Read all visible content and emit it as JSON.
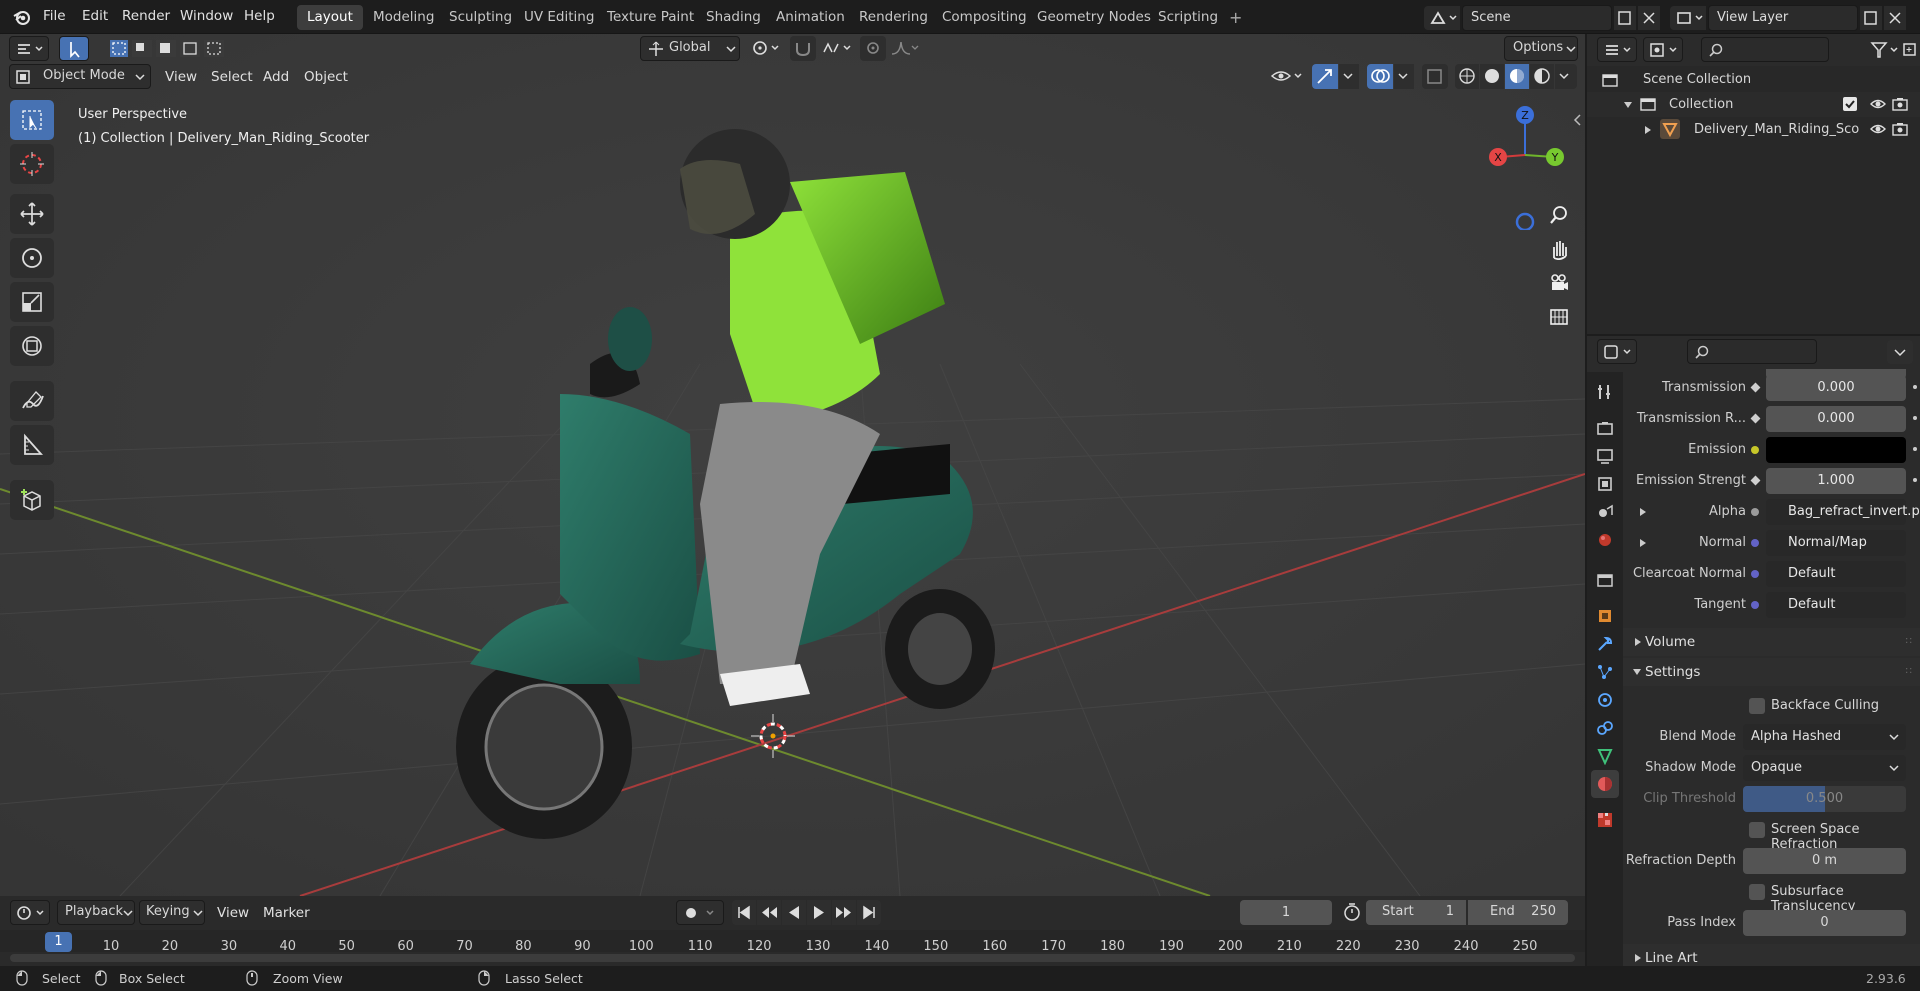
{
  "menus": [
    "File",
    "Edit",
    "Render",
    "Window",
    "Help"
  ],
  "workspaces": [
    "Layout",
    "Modeling",
    "Sculpting",
    "UV Editing",
    "Texture Paint",
    "Shading",
    "Animation",
    "Rendering",
    "Compositing",
    "Geometry Nodes",
    "Scripting"
  ],
  "scene": {
    "label": "Scene"
  },
  "view_layer": {
    "label": "View Layer"
  },
  "vp": {
    "mode": "Object Mode",
    "menu": [
      "View",
      "Select",
      "Add",
      "Object"
    ],
    "orientation": "Global",
    "options": "Options",
    "overlay_title": "User Perspective",
    "overlay_sub": "(1) Collection | Delivery_Man_Riding_Scooter",
    "gizmo": {
      "x": "X",
      "y": "Y",
      "z": "Z"
    }
  },
  "outliner": {
    "root": "Scene Collection",
    "collection": "Collection",
    "object": "Delivery_Man_Riding_Sco"
  },
  "props": {
    "rows": [
      {
        "label": "Transmission",
        "value": "0.000"
      },
      {
        "label": "Transmission R...",
        "value": "0.000"
      },
      {
        "label": "Emission",
        "value": ""
      },
      {
        "label": "Emission Strengt",
        "value": "1.000"
      },
      {
        "label": "Alpha",
        "value": "Bag_refract_invert.p..."
      },
      {
        "label": "Normal",
        "value": "Normal/Map"
      },
      {
        "label": "Clearcoat Normal",
        "value": "Default"
      },
      {
        "label": "Tangent",
        "value": "Default"
      }
    ],
    "volume": "Volume",
    "settings": "Settings",
    "backface": "Backface Culling",
    "blend_label": "Blend Mode",
    "blend": "Alpha Hashed",
    "shadow_label": "Shadow Mode",
    "shadow": "Opaque",
    "clip_label": "Clip Threshold",
    "clip": "0.500",
    "ssr": "Screen Space Refraction",
    "refr_label": "Refraction Depth",
    "refr": "0 m",
    "subsurface": "Subsurface Translucency",
    "pass_label": "Pass Index",
    "pass": "0",
    "lineart": "Line Art"
  },
  "timeline": {
    "menus": [
      "Playback",
      "Keying",
      "View",
      "Marker"
    ],
    "frame": "1",
    "start_label": "Start",
    "start": "1",
    "end_label": "End",
    "end": "250",
    "ticks": [
      "1",
      "10",
      "20",
      "30",
      "40",
      "50",
      "60",
      "70",
      "80",
      "90",
      "100",
      "110",
      "120",
      "130",
      "140",
      "150",
      "160",
      "170",
      "180",
      "190",
      "200",
      "210",
      "220",
      "230",
      "240",
      "250"
    ]
  },
  "status": {
    "select": "Select",
    "box": "Box Select",
    "zoom": "Zoom View",
    "lasso": "Lasso Select",
    "version": "2.93.6"
  },
  "colors": {
    "accent": "#4772b3",
    "grid_x": "#a83c3c",
    "grid_y": "#6d8a2e"
  }
}
